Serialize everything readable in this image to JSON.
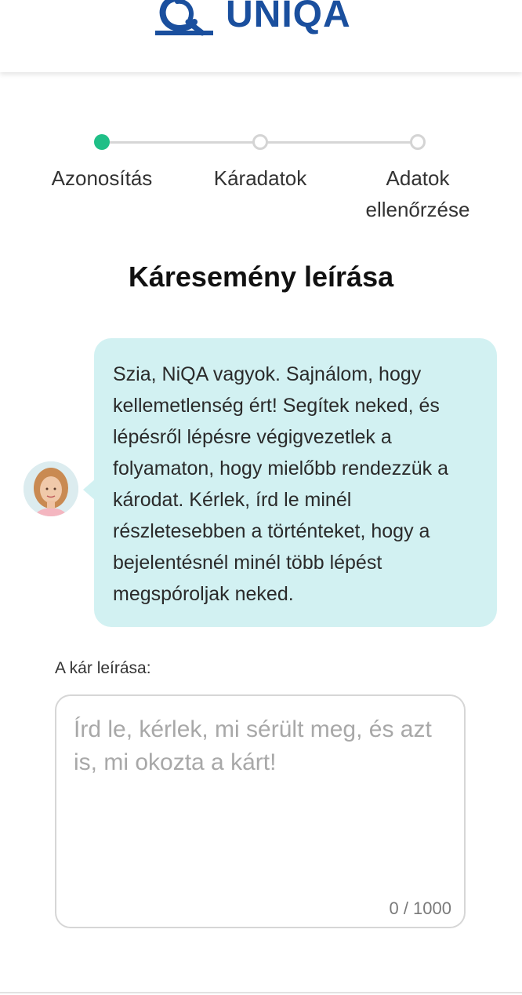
{
  "brand": {
    "name": "UNIQA",
    "color": "#1a4f9e"
  },
  "stepper": {
    "steps": [
      {
        "label_line1": "Azonosítás",
        "label_line2": "",
        "state": "active"
      },
      {
        "label_line1": "Káradatok",
        "label_line2": "",
        "state": "inactive"
      },
      {
        "label_line1": "Adatok",
        "label_line2": "ellenőrzése",
        "state": "inactive"
      }
    ],
    "active_color": "#1fbf87"
  },
  "page": {
    "title": "Káresemény leírása"
  },
  "assistant": {
    "avatar_icon": "assistant-avatar",
    "message": "Szia, NiQA vagyok. Sajnálom, hogy kellemetlenség ért! Segítek neked, és lépésről lépésre végigvezetlek a folyamaton, hogy mielőbb rendezzük a károdat. Kérlek, írd le minél részletesebben a történteket, hogy a bejelentésnél minél több lépést megspóroljak neked.",
    "bubble_color": "#d2f1f2"
  },
  "form": {
    "label": "A kár leírása:",
    "placeholder": "Írd le, kérlek, mi sérült meg, és azt is, mi okozta a kárt!",
    "value": "",
    "counter": "0 / 1000"
  }
}
